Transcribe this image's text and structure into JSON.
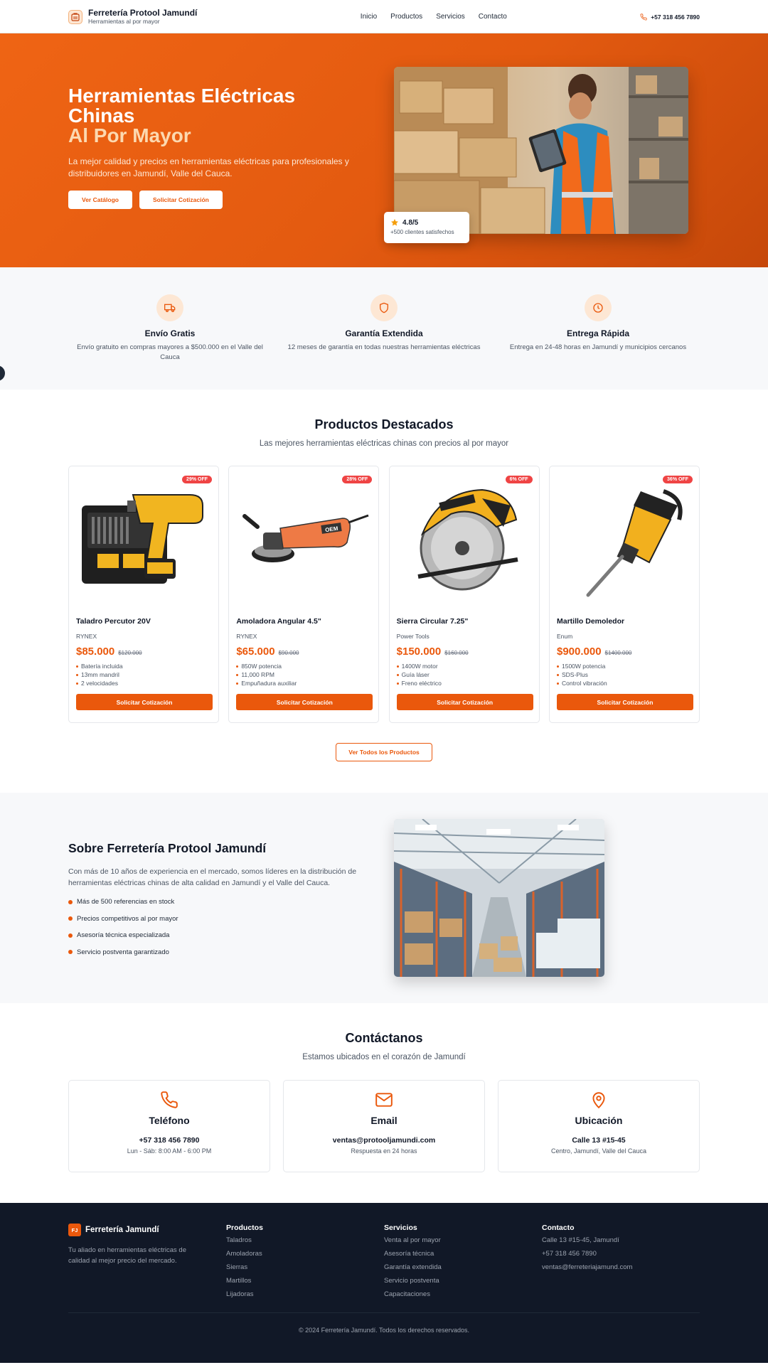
{
  "header": {
    "brand_name": "Ferretería Protool Jamundí",
    "brand_tagline": "Herramientas al por mayor",
    "nav": [
      "Inicio",
      "Productos",
      "Servicios",
      "Contacto"
    ],
    "phone": "+57 318 456 7890"
  },
  "hero": {
    "title_line1": "Herramientas Eléctricas",
    "title_line2": "Chinas",
    "title_accent": "Al Por Mayor",
    "subtitle": "La mejor calidad y precios en herramientas eléctricas para profesionales y distribuidores en Jamundí, Valle del Cauca.",
    "btn_catalog": "Ver Catálogo",
    "btn_quote": "Solicitar Cotización",
    "rating_value": "4.8/5",
    "rating_sub": "+500 clientes satisfechos"
  },
  "features": [
    {
      "icon": "truck-icon",
      "title": "Envío Gratis",
      "desc": "Envío gratuito en compras mayores a $500.000 en el Valle del Cauca"
    },
    {
      "icon": "shield-icon",
      "title": "Garantía Extendida",
      "desc": "12 meses de garantía en todas nuestras herramientas eléctricas"
    },
    {
      "icon": "clock-icon",
      "title": "Entrega Rápida",
      "desc": "Entrega en 24-48 horas en Jamundí y municipios cercanos"
    }
  ],
  "products": {
    "title": "Productos Destacados",
    "subtitle": "Las mejores herramientas eléctricas chinas con precios al por mayor",
    "items": [
      {
        "badge": "29% OFF",
        "name": "Taladro Percutor 20V",
        "brand": "RYNEX",
        "price": "$85.000",
        "old_price": "$120.000",
        "features": [
          "Batería incluida",
          "13mm mandril",
          "2 velocidades"
        ],
        "button": "Solicitar Cotización"
      },
      {
        "badge": "28% OFF",
        "name": "Amoladora Angular 4.5\"",
        "brand": "RYNEX",
        "price": "$65.000",
        "old_price": "$90.000",
        "features": [
          "850W potencia",
          "11,000 RPM",
          "Empuñadura auxiliar"
        ],
        "button": "Solicitar Cotización"
      },
      {
        "badge": "6% OFF",
        "name": "Sierra Circular 7.25\"",
        "brand": "Power Tools",
        "price": "$150.000",
        "old_price": "$160.000",
        "features": [
          "1400W motor",
          "Guía láser",
          "Freno eléctrico"
        ],
        "button": "Solicitar Cotización"
      },
      {
        "badge": "36% OFF",
        "name": "Martillo Demoledor",
        "brand": "Enum",
        "price": "$900.000",
        "old_price": "$1400.000",
        "features": [
          "1500W potencia",
          "SDS-Plus",
          "Control vibración"
        ],
        "button": "Solicitar Cotización"
      }
    ],
    "view_all": "Ver Todos los Productos"
  },
  "about": {
    "title": "Sobre Ferretería Protool Jamundí",
    "desc": "Con más de 10 años de experiencia en el mercado, somos líderes en la distribución de herramientas eléctricas chinas de alta calidad en Jamundí y el Valle del Cauca.",
    "points": [
      "Más de 500 referencias en stock",
      "Precios competitivos al por mayor",
      "Asesoría técnica especializada",
      "Servicio postventa garantizado"
    ]
  },
  "contact": {
    "title": "Contáctanos",
    "subtitle": "Estamos ubicados en el corazón de Jamundí",
    "cards": [
      {
        "icon": "phone-icon",
        "title": "Teléfono",
        "value": "+57 318 456 7890",
        "sub": "Lun - Sáb: 8:00 AM - 6:00 PM"
      },
      {
        "icon": "mail-icon",
        "title": "Email",
        "value": "ventas@protooljamundi.com",
        "sub": "Respuesta en 24 horas"
      },
      {
        "icon": "map-pin-icon",
        "title": "Ubicación",
        "value": "Calle 13 #15-45",
        "sub": "Centro, Jamundí, Valle del Cauca"
      }
    ]
  },
  "footer": {
    "logo_badge": "FJ",
    "brand": "Ferretería Jamundí",
    "desc": "Tu aliado en herramientas eléctricas de calidad al mejor precio del mercado.",
    "col_products": {
      "title": "Productos",
      "links": [
        "Taladros",
        "Amoladoras",
        "Sierras",
        "Martillos",
        "Lijadoras"
      ]
    },
    "col_services": {
      "title": "Servicios",
      "links": [
        "Venta al por mayor",
        "Asesoría técnica",
        "Garantía extendida",
        "Servicio postventa",
        "Capacitaciones"
      ]
    },
    "col_contact": {
      "title": "Contacto",
      "links": [
        "Calle 13 #15-45, Jamundí",
        "+57 318 456 7890",
        "ventas@ferreteriajamund.com"
      ]
    },
    "copyright": "© 2024 Ferretería Jamundí. Todos los derechos reservados."
  },
  "colors": {
    "accent": "#ea580c",
    "badge": "#ef4444",
    "footer_bg": "#111827",
    "soft_bg": "#f7f8fa"
  }
}
